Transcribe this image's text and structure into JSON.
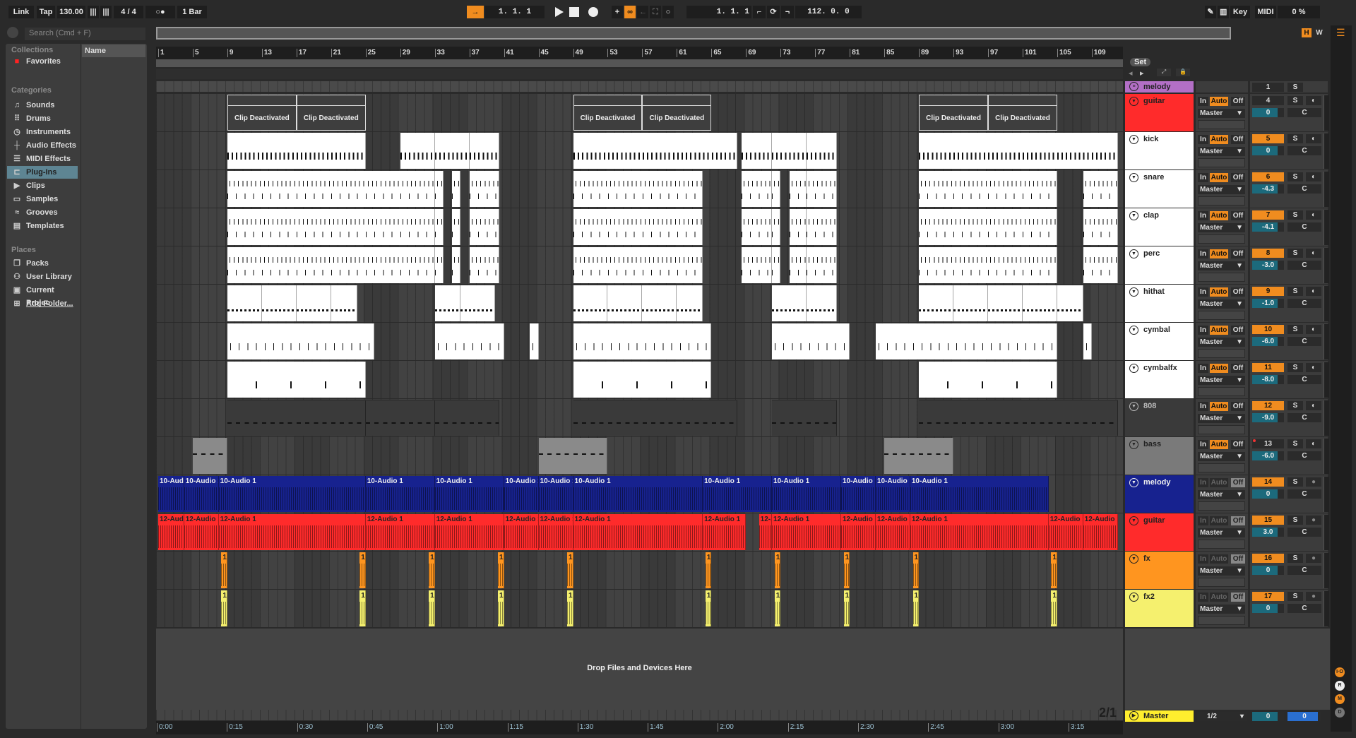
{
  "topbar": {
    "link": "Link",
    "tap": "Tap",
    "tempo": "130.00",
    "signature": "4 / 4",
    "metro": "○●",
    "quant": "1 Bar",
    "position": "1.  1.  1",
    "loop_start": "1.  1.  1",
    "loop_length": "112.  0.  0",
    "key": "Key",
    "midi": "MIDI",
    "cpu": "0 %"
  },
  "browser": {
    "search_placeholder": "Search (Cmd + F)",
    "name_col": "Name",
    "collections_label": "Collections",
    "favorites": "Favorites",
    "categories_label": "Categories",
    "categories": [
      {
        "label": "Sounds",
        "icon": "♫"
      },
      {
        "label": "Drums",
        "icon": "⠿"
      },
      {
        "label": "Instruments",
        "icon": "◷"
      },
      {
        "label": "Audio Effects",
        "icon": "┼"
      },
      {
        "label": "MIDI Effects",
        "icon": "☰"
      },
      {
        "label": "Plug-Ins",
        "icon": "⊏"
      },
      {
        "label": "Clips",
        "icon": "▶"
      },
      {
        "label": "Samples",
        "icon": "▭"
      },
      {
        "label": "Grooves",
        "icon": "≈"
      },
      {
        "label": "Templates",
        "icon": "▤"
      }
    ],
    "selected": "Plug-Ins",
    "places_label": "Places",
    "places": [
      {
        "label": "Packs",
        "icon": "❐"
      },
      {
        "label": "User Library",
        "icon": "⚇"
      },
      {
        "label": "Current Projec",
        "icon": "▣"
      },
      {
        "label": "Add Folder...",
        "icon": "⊞"
      }
    ]
  },
  "ruler": {
    "bars": [
      "1",
      "5",
      "9",
      "13",
      "17",
      "21",
      "25",
      "29",
      "33",
      "37",
      "41",
      "45",
      "49",
      "53",
      "57",
      "61",
      "65",
      "69",
      "73",
      "77",
      "81",
      "85",
      "89",
      "93",
      "97",
      "101",
      "105",
      "109"
    ]
  },
  "timeline": [
    "0:00",
    "0:15",
    "0:30",
    "0:45",
    "1:00",
    "1:15",
    "1:30",
    "1:45",
    "2:00",
    "2:15",
    "2:30",
    "2:45",
    "3:00",
    "3:15"
  ],
  "set": {
    "label": "Set"
  },
  "overview_buttons": {
    "h": "H",
    "w": "W"
  },
  "deactivated_label": "Clip Deactivated",
  "drop_label": "Drop Files and Devices Here",
  "page_indicator": "2/1",
  "io": {
    "in": "In",
    "auto": "Auto",
    "off": "Off",
    "route": "Master",
    "solo": "S",
    "pan": "C"
  },
  "group": {
    "name": "melody",
    "color": "#b36fc6",
    "number": "1"
  },
  "tracks": [
    {
      "name": "guitar",
      "color": "#ff2b2b",
      "text": "#222",
      "num": "4",
      "vol": "0",
      "active": false,
      "midi": true,
      "deact": true,
      "clips": [
        [
          9,
          17
        ],
        [
          17,
          25
        ],
        [
          49,
          57
        ],
        [
          57,
          65
        ],
        [
          89,
          97
        ],
        [
          97,
          105
        ]
      ]
    },
    {
      "name": "kick",
      "color": "#ffffff",
      "text": "#222",
      "num": "5",
      "vol": "0",
      "active": true,
      "midi": true,
      "pattern": "kick",
      "clips": [
        [
          9,
          25
        ],
        [
          29,
          33
        ],
        [
          33,
          37
        ],
        [
          37,
          40.5
        ],
        [
          49,
          68
        ],
        [
          68.5,
          72
        ],
        [
          72,
          76
        ],
        [
          76,
          79.5
        ],
        [
          89,
          112
        ]
      ]
    },
    {
      "name": "snare",
      "color": "#ffffff",
      "text": "#222",
      "num": "6",
      "vol": "-4.3",
      "active": true,
      "midi": true,
      "pattern": "snare",
      "clips": [
        [
          9,
          33
        ],
        [
          33,
          34
        ],
        [
          35,
          36
        ],
        [
          37,
          40.5
        ],
        [
          49,
          64
        ],
        [
          68.5,
          72
        ],
        [
          72,
          73
        ],
        [
          74,
          76
        ],
        [
          76,
          79.5
        ],
        [
          89,
          105
        ],
        [
          108,
          112
        ]
      ]
    },
    {
      "name": "clap",
      "color": "#ffffff",
      "text": "#222",
      "num": "7",
      "vol": "-4.1",
      "active": true,
      "midi": true,
      "pattern": "snare",
      "clips": [
        [
          9,
          33
        ],
        [
          33,
          34
        ],
        [
          35,
          36
        ],
        [
          37,
          40.5
        ],
        [
          49,
          64
        ],
        [
          68.5,
          72
        ],
        [
          72,
          73
        ],
        [
          74,
          76
        ],
        [
          76,
          79.5
        ],
        [
          89,
          105
        ],
        [
          108,
          112
        ]
      ]
    },
    {
      "name": "perc",
      "color": "#ffffff",
      "text": "#222",
      "num": "8",
      "vol": "-3.0",
      "active": true,
      "midi": true,
      "pattern": "snare",
      "clips": [
        [
          9,
          33
        ],
        [
          33,
          34
        ],
        [
          35,
          36
        ],
        [
          37,
          40.5
        ],
        [
          49,
          64
        ],
        [
          68.5,
          72
        ],
        [
          72,
          73
        ],
        [
          74,
          76
        ],
        [
          76,
          79.5
        ],
        [
          89,
          105
        ],
        [
          108,
          112
        ]
      ]
    },
    {
      "name": "hithat",
      "color": "#ffffff",
      "text": "#222",
      "num": "9",
      "vol": "-1.0",
      "active": true,
      "midi": true,
      "pattern": "hat",
      "clips": [
        [
          9,
          13
        ],
        [
          13,
          17
        ],
        [
          17,
          21
        ],
        [
          21,
          24
        ],
        [
          33,
          36
        ],
        [
          36,
          40
        ],
        [
          49,
          53
        ],
        [
          53,
          57
        ],
        [
          57,
          61
        ],
        [
          61,
          64
        ],
        [
          72,
          76
        ],
        [
          76,
          79.5
        ],
        [
          89,
          93
        ],
        [
          93,
          97
        ],
        [
          97,
          101
        ],
        [
          101,
          105
        ],
        [
          105,
          108
        ]
      ]
    },
    {
      "name": "cymbal",
      "color": "#ffffff",
      "text": "#222",
      "num": "10",
      "vol": "-6.0",
      "active": true,
      "midi": true,
      "pattern": "cym",
      "clips": [
        [
          9,
          26
        ],
        [
          33,
          41
        ],
        [
          44,
          45
        ],
        [
          49,
          65
        ],
        [
          72,
          81
        ],
        [
          84,
          105
        ],
        [
          108,
          109
        ]
      ]
    },
    {
      "name": "cymbalfx",
      "color": "#ffffff",
      "text": "#222",
      "num": "11",
      "vol": "-8.0",
      "active": true,
      "midi": true,
      "pattern": "cymfx",
      "clips": [
        [
          9,
          25
        ],
        [
          49,
          65
        ],
        [
          89,
          105
        ]
      ]
    },
    {
      "name": "808",
      "color": "#3a3a3a",
      "text": "#bbb",
      "num": "12",
      "vol": "-9.0",
      "active": true,
      "midi": true,
      "pattern": "dark",
      "clips": [
        [
          9,
          25
        ],
        [
          25,
          33
        ],
        [
          33,
          40.5
        ],
        [
          49,
          68
        ],
        [
          72,
          79.5
        ],
        [
          89,
          112
        ]
      ]
    },
    {
      "name": "bass",
      "color": "#7a7a7a",
      "text": "#222",
      "num": "13",
      "vol": "-6.0",
      "active": false,
      "rec": true,
      "midi": true,
      "pattern": "gray",
      "clips": [
        [
          5,
          9
        ],
        [
          45,
          53
        ],
        [
          85,
          93
        ]
      ]
    },
    {
      "name": "melody",
      "color": "#17228f",
      "text": "#eee",
      "num": "14",
      "vol": "0",
      "active": true,
      "midi": false,
      "label": "10-Audio 1",
      "clips": [
        [
          1,
          4
        ],
        [
          4,
          8
        ],
        [
          8,
          25
        ],
        [
          25,
          33
        ],
        [
          33,
          41
        ],
        [
          41,
          45
        ],
        [
          45,
          49
        ],
        [
          49,
          64
        ],
        [
          64,
          72
        ],
        [
          72,
          80
        ],
        [
          80,
          84
        ],
        [
          84,
          88
        ],
        [
          88,
          104
        ]
      ]
    },
    {
      "name": "guitar",
      "color": "#ff2b2b",
      "text": "#222",
      "num": "15",
      "vol": "3.0",
      "active": true,
      "midi": false,
      "label": "12-Audio 1",
      "clips": [
        [
          1,
          4
        ],
        [
          4,
          8
        ],
        [
          8,
          25
        ],
        [
          25,
          33
        ],
        [
          33,
          41
        ],
        [
          41,
          45
        ],
        [
          45,
          49
        ],
        [
          49,
          64
        ],
        [
          64,
          69
        ],
        [
          70.5,
          72
        ],
        [
          72,
          80
        ],
        [
          80,
          84
        ],
        [
          84,
          88
        ],
        [
          88,
          104
        ],
        [
          104,
          108
        ],
        [
          108,
          112
        ]
      ]
    },
    {
      "name": "fx",
      "color": "#ff951f",
      "text": "#222",
      "num": "16",
      "vol": "0",
      "active": true,
      "midi": false,
      "label": "1",
      "clips": [
        [
          8.3,
          9
        ],
        [
          24.3,
          25
        ],
        [
          32.3,
          33
        ],
        [
          40.3,
          41
        ],
        [
          48.3,
          49
        ],
        [
          64.3,
          65
        ],
        [
          72.3,
          73
        ],
        [
          80.3,
          81
        ],
        [
          88.3,
          89
        ],
        [
          104.3,
          105
        ]
      ]
    },
    {
      "name": "fx2",
      "color": "#f5f06e",
      "text": "#222",
      "num": "17",
      "vol": "0",
      "active": true,
      "midi": false,
      "label": "1",
      "clips": [
        [
          8.3,
          9
        ],
        [
          24.3,
          25
        ],
        [
          32.3,
          33
        ],
        [
          40.3,
          41
        ],
        [
          48.3,
          49
        ],
        [
          64.3,
          65
        ],
        [
          72.3,
          73
        ],
        [
          80.3,
          81
        ],
        [
          88.3,
          89
        ],
        [
          104.3,
          105
        ]
      ]
    }
  ],
  "master": {
    "name": "Master",
    "color": "#ffee2e",
    "route": "1/2",
    "vol": "0",
    "pan": "0"
  },
  "side_buttons": [
    "I·O",
    "R",
    "M",
    "D"
  ]
}
